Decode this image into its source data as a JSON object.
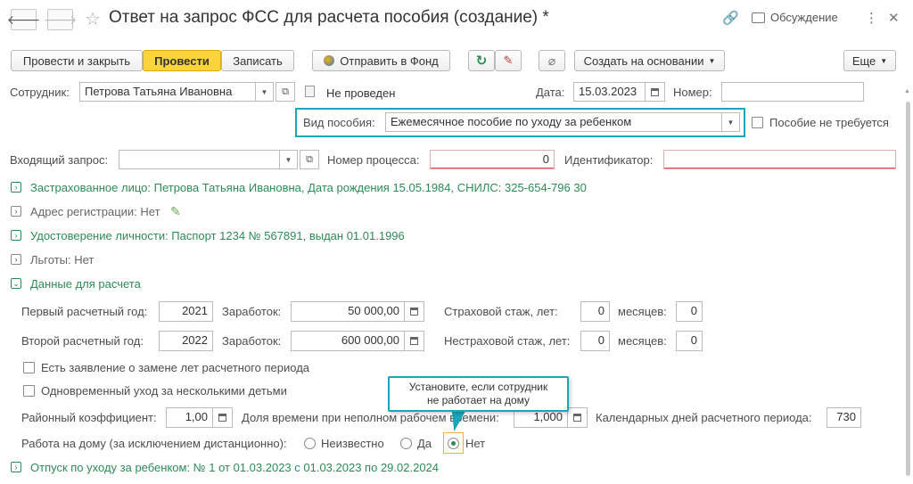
{
  "window": {
    "title": "Ответ на запрос ФСС для расчета пособия (создание) *",
    "discussion_label": "Обсуждение"
  },
  "toolbar": {
    "post_close": "Провести и закрыть",
    "post": "Провести",
    "save": "Записать",
    "send_fund": "Отправить в Фонд",
    "create_based": "Создать на основании",
    "more": "Еще"
  },
  "header": {
    "employee_label": "Сотрудник:",
    "employee_value": "Петрова Татьяна Ивановна",
    "status_label": "Не проведен",
    "date_label": "Дата:",
    "date_value": "15.03.2023",
    "number_label": "Номер:",
    "number_value": ""
  },
  "benefit": {
    "type_label": "Вид пособия:",
    "type_value": "Ежемесячное пособие по уходу за ребенком",
    "not_required_label": "Пособие не требуется"
  },
  "request": {
    "incoming_label": "Входящий запрос:",
    "incoming_value": "",
    "process_label": "Номер процесса:",
    "process_value": "0",
    "id_label": "Идентификатор:",
    "id_value": ""
  },
  "sections": {
    "insured": "Застрахованное лицо: Петрова Татьяна Ивановна, Дата рождения 15.05.1984, СНИЛС: 325-654-796 30",
    "address": "Адрес регистрации: Нет",
    "identity": "Удостоверение личности: Паспорт 1234 № 567891, выдан 01.01.1996",
    "benefits": "Льготы: Нет",
    "calc_data": "Данные для расчета",
    "leave": "Отпуск по уходу за ребенком: № 1 от 01.03.2023 с 01.03.2023 по 29.02.2024"
  },
  "calc": {
    "first_year_label": "Первый расчетный год:",
    "first_year": "2021",
    "earnings_label": "Заработок:",
    "first_earnings": "50 000,00",
    "insurance_exp_label": "Страховой стаж, лет:",
    "insurance_years": "0",
    "months_label": "месяцев:",
    "insurance_months": "0",
    "second_year_label": "Второй расчетный год:",
    "second_year": "2022",
    "second_earnings": "600 000,00",
    "noninsurance_exp_label": "Нестраховой стаж, лет:",
    "noninsurance_years": "0",
    "noninsurance_months": "0",
    "replace_years_label": "Есть заявление о замене лет расчетного периода",
    "multiple_children_label": "Одновременный уход за несколькими детьми",
    "regional_coef_label": "Районный коэффициент:",
    "regional_coef": "1,00",
    "part_time_label": "Доля времени при неполном рабочем времени:",
    "part_time": "1,000",
    "calendar_days_label": "Календарных дней расчетного периода:",
    "calendar_days": "730",
    "home_work_label": "Работа на дому (за исключением дистанционно):",
    "opt_unknown": "Неизвестно",
    "opt_yes": "Да",
    "opt_no": "Нет",
    "home_work_selected": "Нет"
  },
  "tooltip": {
    "line1": "Установите, если сотрудник",
    "line2": "не работает на дому"
  }
}
